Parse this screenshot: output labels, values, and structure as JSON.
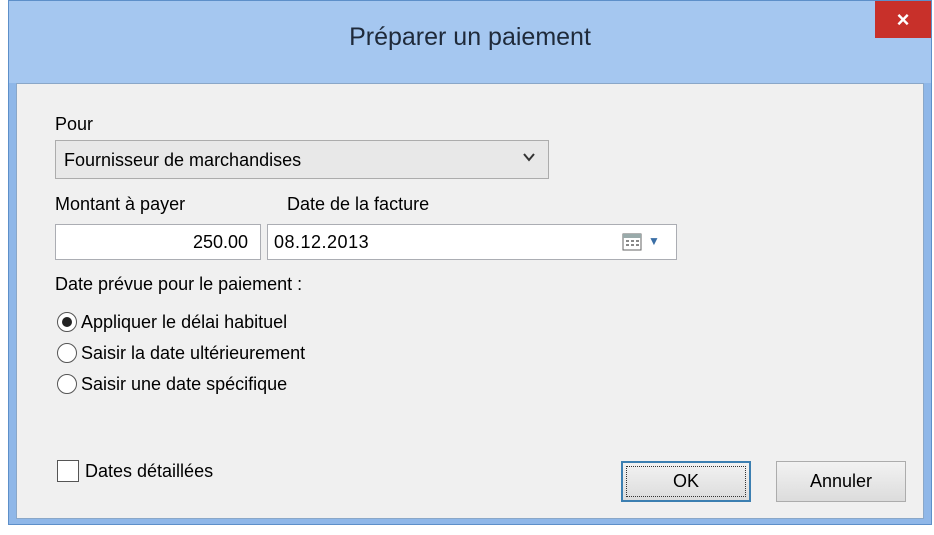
{
  "window": {
    "title": "Préparer un paiement",
    "close_glyph": "×"
  },
  "form": {
    "pour_label": "Pour",
    "pour_value": "Fournisseur de marchandises",
    "amount_label": "Montant à payer",
    "amount_value": "250.00",
    "invoice_date_label": "Date de la facture",
    "invoice_date_value": "08.12.2013",
    "payment_date_label": "Date prévue pour le paiement :",
    "radios": [
      {
        "label": "Appliquer le délai habituel",
        "selected": true
      },
      {
        "label": "Saisir la date ultérieurement",
        "selected": false
      },
      {
        "label": "Saisir une date spécifique",
        "selected": false
      }
    ],
    "detailed_dates_label": "Dates détaillées",
    "detailed_dates_checked": false
  },
  "buttons": {
    "ok": "OK",
    "cancel": "Annuler"
  },
  "icons": {
    "dropdown": "chevron-down-icon",
    "calendar": "calendar-icon",
    "close": "close-icon"
  },
  "colors": {
    "titlebar": "#a5c7f0",
    "close": "#c8302a",
    "focus_border": "#3c7fb1"
  }
}
